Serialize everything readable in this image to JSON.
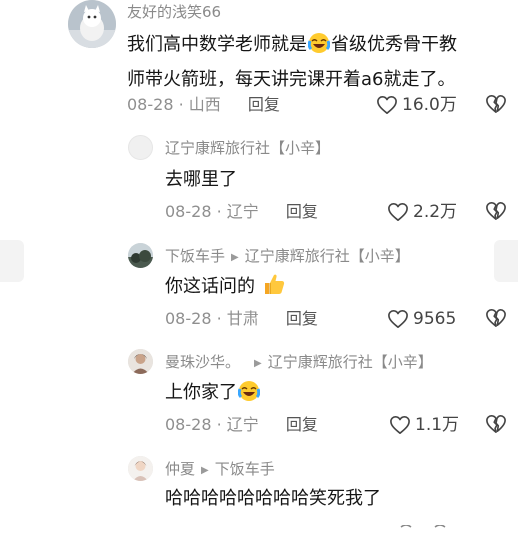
{
  "comments": [
    {
      "user": "友好的浅笑66",
      "text_line1_a": "我们高中数学老师就是",
      "text_line1_b": "省级优秀骨干教",
      "text_line2": "师带火箭班，每天讲完课开着a6就走了。",
      "date": "08-28",
      "location": "山西",
      "reply_label": "回复",
      "likes": "16.0万"
    },
    {
      "user": "辽宁康辉旅行社【小辛】",
      "text": "去哪里了",
      "date": "08-28",
      "location": "辽宁",
      "reply_label": "回复",
      "likes": "2.2万"
    },
    {
      "user": "下饭车手",
      "reply_to": "辽宁康辉旅行社【小辛】",
      "text": "你这话问的",
      "date": "08-28",
      "location": "甘肃",
      "reply_label": "回复",
      "likes": "9565"
    },
    {
      "user": "曼珠沙华。",
      "reply_to": "辽宁康辉旅行社【小辛】",
      "text": "上你家了",
      "date": "08-28",
      "location": "辽宁",
      "reply_label": "回复",
      "likes": "1.1万"
    },
    {
      "user": "仲夏",
      "reply_to": "下饭车手",
      "text": "哈哈哈哈哈哈哈哈笑死我了"
    }
  ],
  "colors": {
    "name_gray": "#8a8a8a",
    "meta_gray": "#8f8f8f",
    "text": "#161616",
    "icon": "#444444"
  },
  "icons": {
    "like": "heart-outline-icon",
    "dislike": "broken-heart-icon",
    "separator": "triangle-right-icon",
    "laugh_cry": "laughing-crying-emoji",
    "thumbs_up": "thumbs-up-emoji"
  }
}
